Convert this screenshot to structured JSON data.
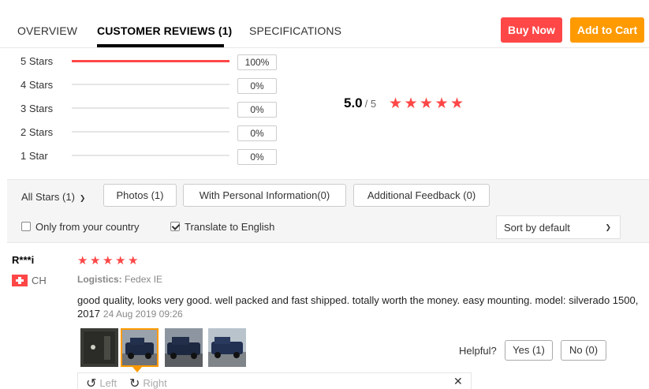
{
  "tabs": [
    {
      "label": "OVERVIEW"
    },
    {
      "label": "CUSTOMER REVIEWS (1)"
    },
    {
      "label": "SPECIFICATIONS"
    }
  ],
  "actions": {
    "buy_now": "Buy Now",
    "add_to_cart": "Add to Cart"
  },
  "colors": {
    "accent_red": "#ff4747",
    "accent_orange": "#ff9a00"
  },
  "rating_distribution": [
    {
      "label": "5 Stars",
      "percent_text": "100%",
      "fraction": 1.0
    },
    {
      "label": "4 Stars",
      "percent_text": "0%",
      "fraction": 0
    },
    {
      "label": "3 Stars",
      "percent_text": "0%",
      "fraction": 0
    },
    {
      "label": "2 Stars",
      "percent_text": "0%",
      "fraction": 0
    },
    {
      "label": "1 Star",
      "percent_text": "0%",
      "fraction": 0
    }
  ],
  "overall": {
    "score": "5.0",
    "out_of": "/ 5",
    "stars": 5
  },
  "filters": {
    "all_stars": "All Stars (1)",
    "photos": "Photos (1)",
    "personal_info": "With Personal Information(0)",
    "additional_feedback": "Additional Feedback (0)",
    "only_country": "Only from your country",
    "only_country_checked": false,
    "translate": "Translate to English",
    "translate_checked": true,
    "sort": "Sort by default"
  },
  "review": {
    "reviewer": "R***i",
    "country": "CH",
    "stars": 5,
    "logistics_label": "Logistics:",
    "logistics_value": "Fedex IE",
    "text": "good quality, looks very good. well packed and fast shipped. totally worth the money. easy mounting. model: silverado 1500, 2017",
    "date": "24 Aug 2019 09:26",
    "photos_count": 4,
    "active_photo_index": 1,
    "helpful_label": "Helpful?",
    "yes": "Yes (1)",
    "no": "No (0)"
  },
  "viewer": {
    "left": "Left",
    "right": "Right"
  }
}
